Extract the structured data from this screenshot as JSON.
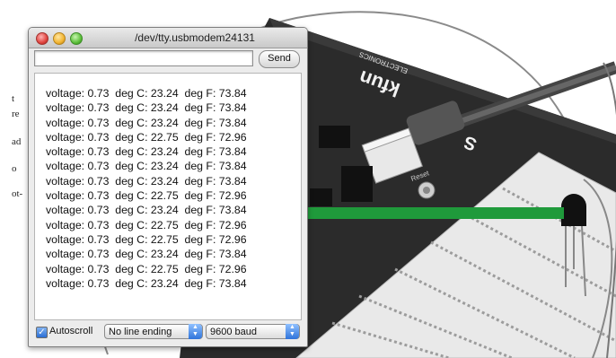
{
  "window": {
    "title": "/dev/tty.usbmodem24131",
    "send_input_value": "",
    "send_label": "Send",
    "autoscroll_label": "Autoscroll",
    "autoscroll_checked": true,
    "line_ending_value": "No line ending",
    "baud_value": "9600 baud"
  },
  "output_lines": [
    "voltage: 0.73  deg C: 23.24  deg F: 73.84",
    "voltage: 0.73  deg C: 23.24  deg F: 73.84",
    "voltage: 0.73  deg C: 23.24  deg F: 73.84",
    "voltage: 0.73  deg C: 22.75  deg F: 72.96",
    "voltage: 0.73  deg C: 23.24  deg F: 73.84",
    "voltage: 0.73  deg C: 23.24  deg F: 73.84",
    "voltage: 0.73  deg C: 23.24  deg F: 73.84",
    "voltage: 0.73  deg C: 22.75  deg F: 72.96",
    "voltage: 0.73  deg C: 23.24  deg F: 73.84",
    "voltage: 0.73  deg C: 22.75  deg F: 72.96",
    "voltage: 0.73  deg C: 22.75  deg F: 72.96",
    "voltage: 0.73  deg C: 23.24  deg F: 73.84",
    "voltage: 0.73  deg C: 22.75  deg F: 72.96",
    "voltage: 0.73  deg C: 23.24  deg F: 73.84"
  ],
  "background": {
    "margin_text_fragments": [
      "t",
      "re",
      "ad",
      "o",
      "ot-"
    ],
    "board_brand": "kfun",
    "board_subtext": "ELECTRONICS",
    "reset_label": "Reset",
    "arrow_color": "#1f9a3b"
  }
}
